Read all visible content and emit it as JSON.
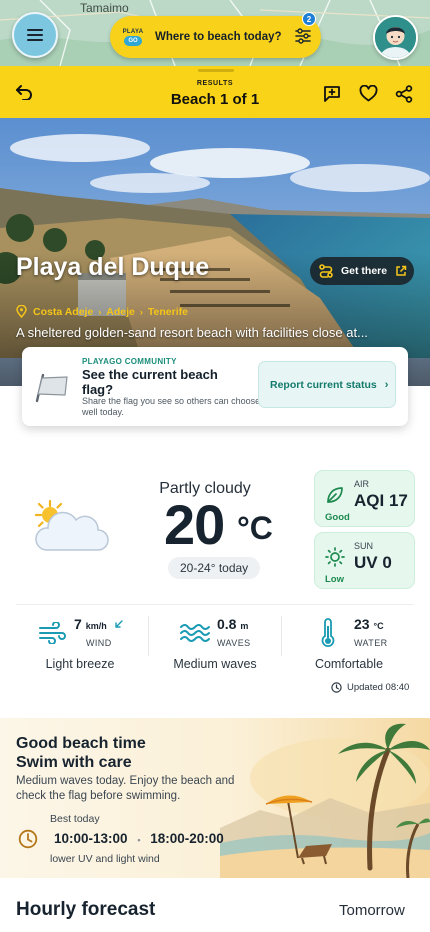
{
  "map": {
    "town_label": "Tamaimo"
  },
  "search": {
    "logo_top": "PLAYA",
    "logo_bottom": "GO",
    "placeholder": "Where to beach today?",
    "filter_count": "2"
  },
  "header": {
    "results_label": "RESULTS",
    "beach_position": "Beach 1 of 1"
  },
  "beach": {
    "name": "Playa del Duque",
    "get_there_label": "Get there",
    "breadcrumb": [
      "Costa Adeje",
      "Adeje",
      "Tenerife"
    ],
    "description": "A sheltered golden-sand resort beach with facilities close at..."
  },
  "community": {
    "tag": "PLAYAGO COMMUNITY",
    "question": "See the current beach flag?",
    "subtext": "Share the flag you see so others can choose well today.",
    "button_label": "Report current status",
    "chevron": "›"
  },
  "weather": {
    "condition": "Partly cloudy",
    "temperature": "20",
    "unit": "°C",
    "range": "20-24°  today",
    "air": {
      "label": "AIR",
      "value": "AQI 17",
      "status": "Good"
    },
    "sun": {
      "label": "SUN",
      "value": "UV 0",
      "status": "Low"
    },
    "wind": {
      "value": "7",
      "unit": "km/h",
      "label": "WIND",
      "description": "Light breeze"
    },
    "waves": {
      "value": "0.8",
      "unit": "m",
      "label": "WAVES",
      "description": "Medium waves"
    },
    "water": {
      "value": "23",
      "unit": "°C",
      "label": "WATER",
      "description": "Comfortable"
    },
    "updated": "Updated  08:40"
  },
  "banner": {
    "line1": "Good beach time",
    "line2": "Swim with care",
    "text": "Medium waves today. Enjoy the beach and check the flag before swimming.",
    "best_label": "Best today",
    "time1": "10:00-13:00",
    "time2": "18:00-20:00",
    "separator": "•",
    "reason": "lower UV and light wind"
  },
  "hourly": {
    "title": "Hourly forecast",
    "tab": "Tomorrow"
  },
  "colors": {
    "brand_yellow": "#f9d317",
    "accent_teal": "#1a8d7a",
    "metric_green": "#1e8a4f"
  }
}
